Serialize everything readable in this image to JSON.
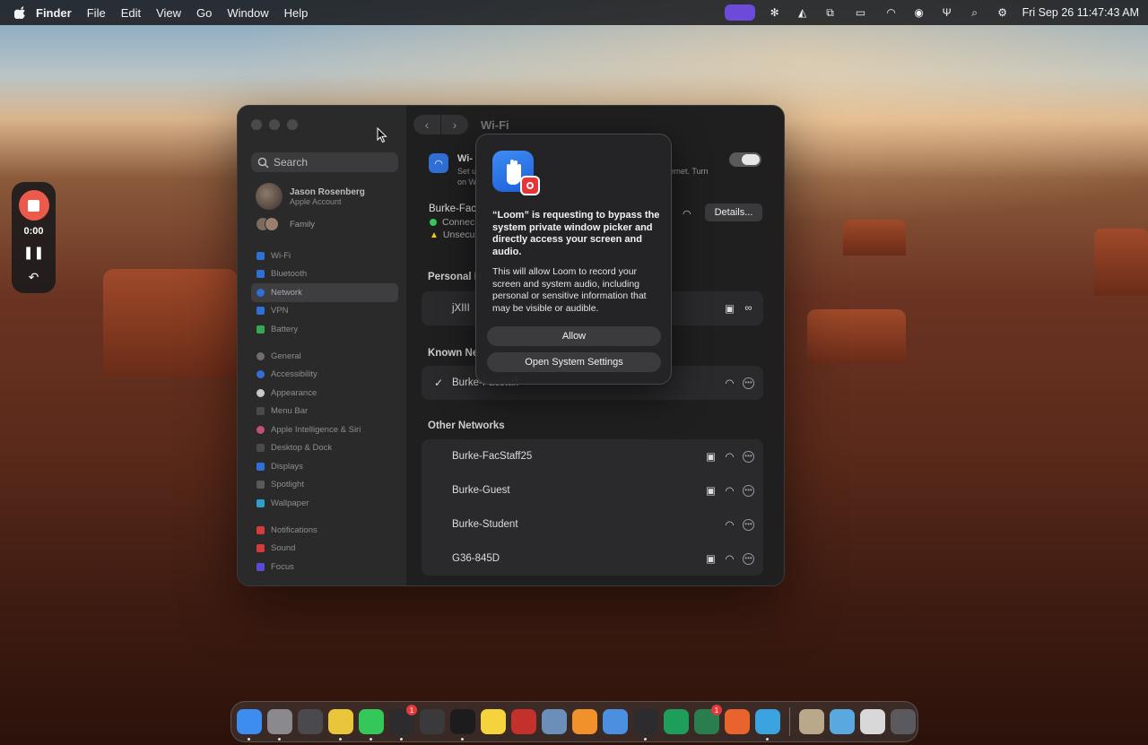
{
  "menubar": {
    "app_name": "Finder",
    "items": [
      "File",
      "Edit",
      "View",
      "Go",
      "Window",
      "Help"
    ],
    "clock": "Fri Sep 26  11:47:43 AM"
  },
  "loom": {
    "time": "0:00"
  },
  "window": {
    "title": "Wi-Fi",
    "search_placeholder": "Search",
    "account": {
      "name": "Jason Rosenberg",
      "sub": "Apple Account"
    },
    "family": "Family",
    "sidebar_group1": [
      "Wi-Fi",
      "Bluetooth",
      "Network",
      "VPN",
      "Battery"
    ],
    "sidebar_group2": [
      "General",
      "Accessibility",
      "Appearance",
      "Menu Bar",
      "Apple Intelligence & Siri",
      "Desktop & Dock",
      "Displays",
      "Spotlight",
      "Wallpaper"
    ],
    "sidebar_group3": [
      "Notifications",
      "Sound",
      "Focus"
    ],
    "active_item": "Network",
    "wifi_row": {
      "label": "Wi-",
      "sub1": "Set u",
      "sub2": "on W",
      "sub_tail": "ernet. Turn"
    },
    "current": {
      "name": "Burke-Fac",
      "connected": "Connec",
      "unsecured": "Unsecu",
      "details": "Details..."
    },
    "personal_header": "Personal H",
    "personal": [
      {
        "name": "jXIII"
      }
    ],
    "known_header": "Known Ne",
    "known": [
      {
        "name": "Burke-Facstaff"
      }
    ],
    "other_header": "Other Networks",
    "other": [
      {
        "name": "Burke-FacStaff25",
        "locked": true
      },
      {
        "name": "Burke-Guest",
        "locked": true
      },
      {
        "name": "Burke-Student",
        "locked": false
      },
      {
        "name": "G36-845D",
        "locked": true
      }
    ]
  },
  "dialog": {
    "title": "“Loom” is requesting to bypass the system private window picker and directly access your screen and audio.",
    "body": "This will allow Loom to record your screen and system audio, including personal or sensitive information that may be visible or audible.",
    "allow": "Allow",
    "open_settings": "Open System Settings"
  },
  "dock": {
    "apps": [
      {
        "name": "finder-icon",
        "color": "#3d8cf0",
        "badge": "",
        "running": true
      },
      {
        "name": "system-settings-icon",
        "color": "#8a8a8e",
        "badge": "",
        "running": true
      },
      {
        "name": "launchpad-icon",
        "color": "#4a4a4e",
        "badge": "",
        "running": false
      },
      {
        "name": "chrome-icon",
        "color": "#e8c53a",
        "badge": "",
        "running": true
      },
      {
        "name": "messages-icon",
        "color": "#34c759",
        "badge": "",
        "running": true
      },
      {
        "name": "reminders-icon",
        "color": "#2c2c2e",
        "badge": "1",
        "running": true
      },
      {
        "name": "screenshot-icon",
        "color": "#3a3a3c",
        "badge": "",
        "running": false
      },
      {
        "name": "terminal-icon",
        "color": "#1c1c1e",
        "badge": "",
        "running": true
      },
      {
        "name": "notes-icon",
        "color": "#f5d33c",
        "badge": "",
        "running": false
      },
      {
        "name": "filezilla-icon",
        "color": "#c4302b",
        "badge": "",
        "running": false
      },
      {
        "name": "weather-icon",
        "color": "#6b8fb8",
        "badge": "",
        "running": false
      },
      {
        "name": "sublime-icon",
        "color": "#f0912c",
        "badge": "",
        "running": false
      },
      {
        "name": "typora-icon",
        "color": "#4b8fe0",
        "badge": "",
        "running": false
      },
      {
        "name": "gear-icon",
        "color": "#2c2c2e",
        "badge": "",
        "running": true
      },
      {
        "name": "pycharm-icon",
        "color": "#1d9e5a",
        "badge": "",
        "running": false
      },
      {
        "name": "bbedit-icon",
        "color": "#2a7d4f",
        "badge": "1",
        "running": false
      },
      {
        "name": "arrow-app-icon",
        "color": "#e8642c",
        "badge": "",
        "running": false
      },
      {
        "name": "quicktime-icon",
        "color": "#3ba3e0",
        "badge": "",
        "running": true
      }
    ],
    "right": [
      {
        "name": "stack-icon",
        "color": "#b9a98a"
      },
      {
        "name": "folder-icon",
        "color": "#5aa8e0"
      },
      {
        "name": "drive-icon",
        "color": "#d8d8d8"
      },
      {
        "name": "trash-icon",
        "color": "#5a5a5e"
      }
    ]
  }
}
